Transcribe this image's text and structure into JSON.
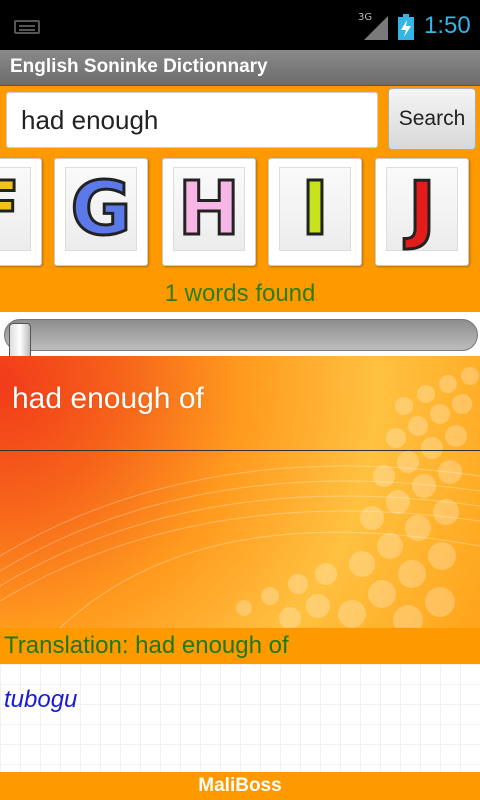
{
  "status_bar": {
    "network": "3G",
    "time": "1:50",
    "time_color": "#33b5e5",
    "icons": [
      "keyboard-icon",
      "signal-icon",
      "battery-charging-icon"
    ]
  },
  "app": {
    "title": "English Soninke Dictionnary"
  },
  "search": {
    "value": "had enough",
    "button_label": "Search"
  },
  "letters": [
    {
      "char": "F",
      "color": "#f2c21b"
    },
    {
      "char": "G",
      "color": "#5b79e8"
    },
    {
      "char": "H",
      "color": "#f7b6e6"
    },
    {
      "char": "I",
      "color": "#c5e21a"
    },
    {
      "char": "J",
      "color": "#e41c1c"
    }
  ],
  "results": {
    "count_text": "1 words found",
    "items": [
      "had enough of"
    ]
  },
  "translation": {
    "label": "Translation: had enough of",
    "text": "tubogu"
  },
  "footer": {
    "text": "MaliBoss"
  },
  "colors": {
    "accent": "#ff9900",
    "found_text": "#2e7d12",
    "translation_text": "#1a1ad6"
  }
}
